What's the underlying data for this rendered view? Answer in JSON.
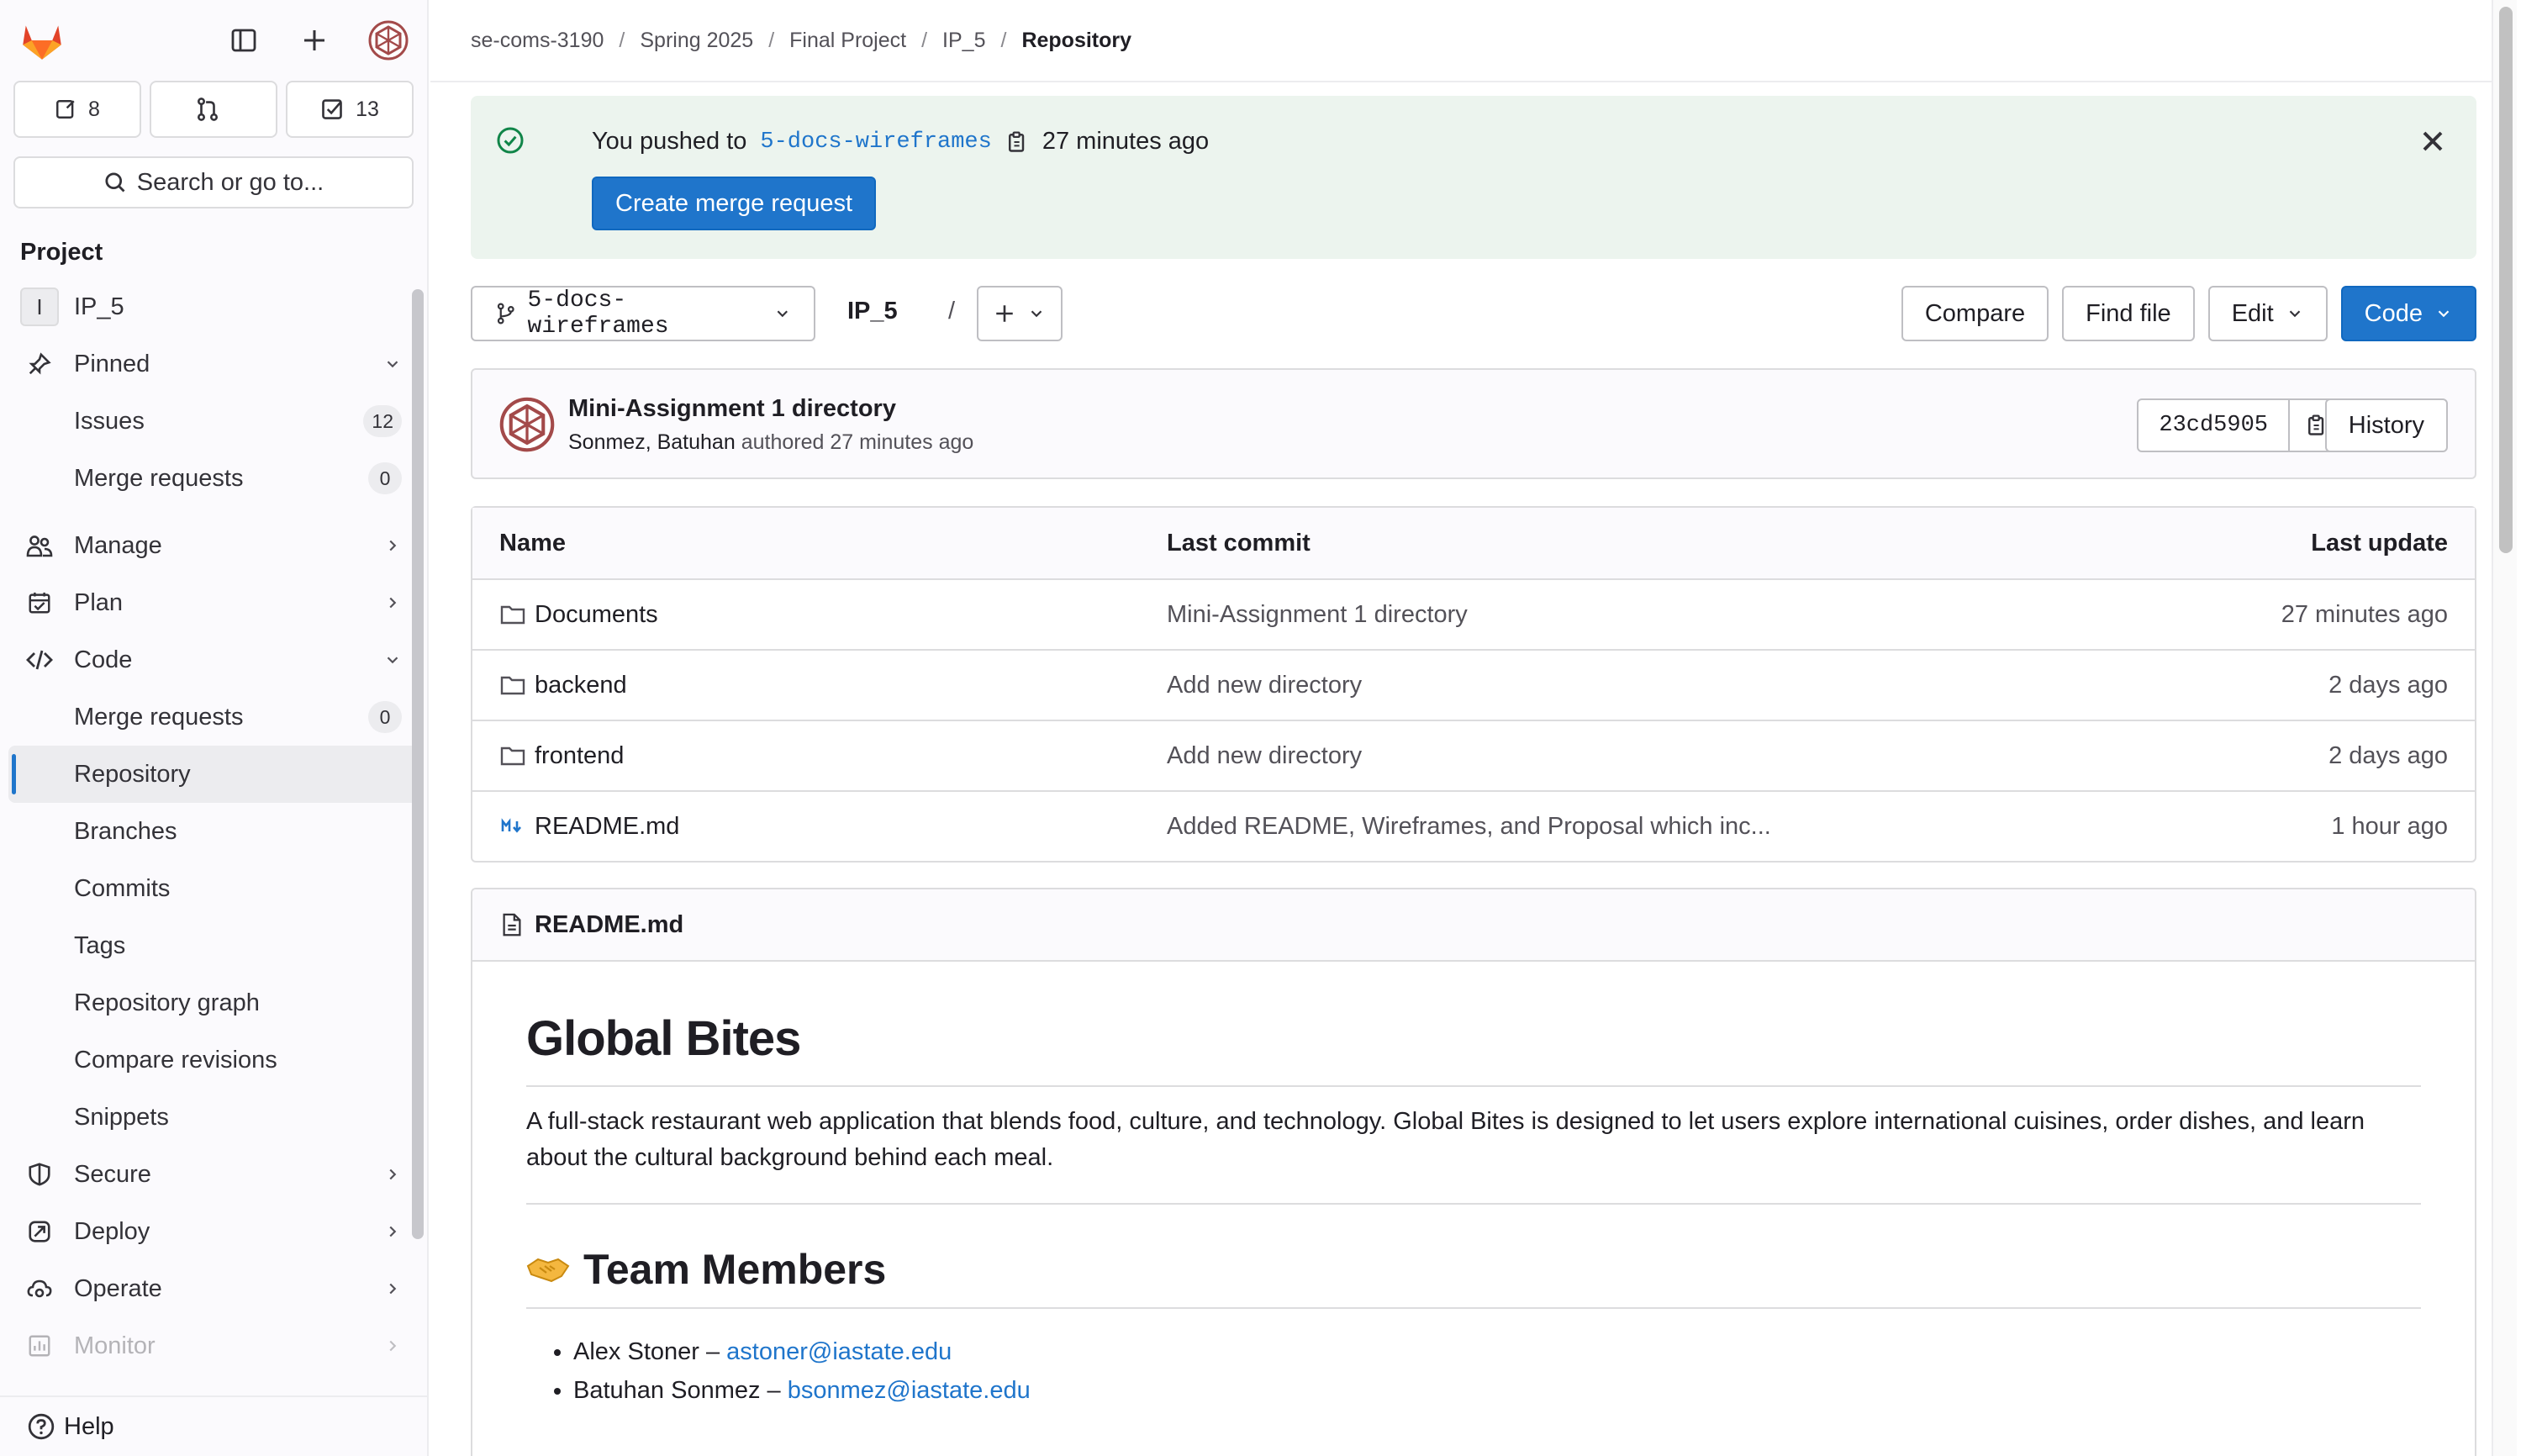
{
  "sidebar": {
    "counts": {
      "issues": "8",
      "merge_requests": "",
      "todos": "13"
    },
    "search_label": "Search or go to...",
    "section_title": "Project",
    "project": {
      "letter": "I",
      "name": "IP_5"
    },
    "items": {
      "pinned": "Pinned",
      "issues": "Issues",
      "issues_count": "12",
      "pinned_mr": "Merge requests",
      "pinned_mr_count": "0",
      "manage": "Manage",
      "plan": "Plan",
      "code": "Code",
      "code_mr": "Merge requests",
      "code_mr_count": "0",
      "repository": "Repository",
      "branches": "Branches",
      "commits": "Commits",
      "tags": "Tags",
      "repository_graph": "Repository graph",
      "compare_revisions": "Compare revisions",
      "snippets": "Snippets",
      "secure": "Secure",
      "deploy": "Deploy",
      "operate": "Operate",
      "monitor": "Monitor"
    },
    "help": "Help"
  },
  "breadcrumb": [
    "se-coms-3190",
    "Spring 2025",
    "Final Project",
    "IP_5",
    "Repository"
  ],
  "alert": {
    "prefix": "You pushed to",
    "branch": "5-docs-wireframes",
    "time": "27 minutes ago",
    "button": "Create merge request"
  },
  "toolbar": {
    "branch": "5-docs-wireframes",
    "path": "IP_5",
    "path_sep": "/",
    "compare": "Compare",
    "find_file": "Find file",
    "edit": "Edit",
    "code": "Code"
  },
  "commit": {
    "title": "Mini-Assignment 1 directory",
    "author": "Sonmez, Batuhan",
    "meta": "authored 27 minutes ago",
    "sha": "23cd5905",
    "history": "History"
  },
  "files": {
    "headers": {
      "name": "Name",
      "last_commit": "Last commit",
      "last_update": "Last update"
    },
    "rows": [
      {
        "name": "Documents",
        "commit": "Mini-Assignment 1 directory",
        "date": "27 minutes ago",
        "icon": "folder-icon"
      },
      {
        "name": "backend",
        "commit": "Add new directory",
        "date": "2 days ago",
        "icon": "folder-icon"
      },
      {
        "name": "frontend",
        "commit": "Add new directory",
        "date": "2 days ago",
        "icon": "folder-icon"
      },
      {
        "name": "README.md",
        "commit": "Added README, Wireframes, and Proposal which inc...",
        "date": "1 hour ago",
        "icon": "markdown-icon"
      }
    ]
  },
  "readme": {
    "filename": "README.md",
    "title": "Global Bites",
    "description": "A full-stack restaurant web application that blends food, culture, and technology. Global Bites is designed to let users explore international cuisines, order dishes, and learn about the cultural background behind each meal.",
    "team_heading": "Team Members",
    "members": [
      {
        "name": "Alex Stoner – ",
        "email": "astoner@iastate.edu"
      },
      {
        "name": "Batuhan Sonmez – ",
        "email": "bsonmez@iastate.edu"
      }
    ]
  },
  "colors": {
    "accent": "#1f75cb",
    "alert_bg": "#ecf4ee",
    "success": "#108548",
    "logo": "#e24329"
  }
}
